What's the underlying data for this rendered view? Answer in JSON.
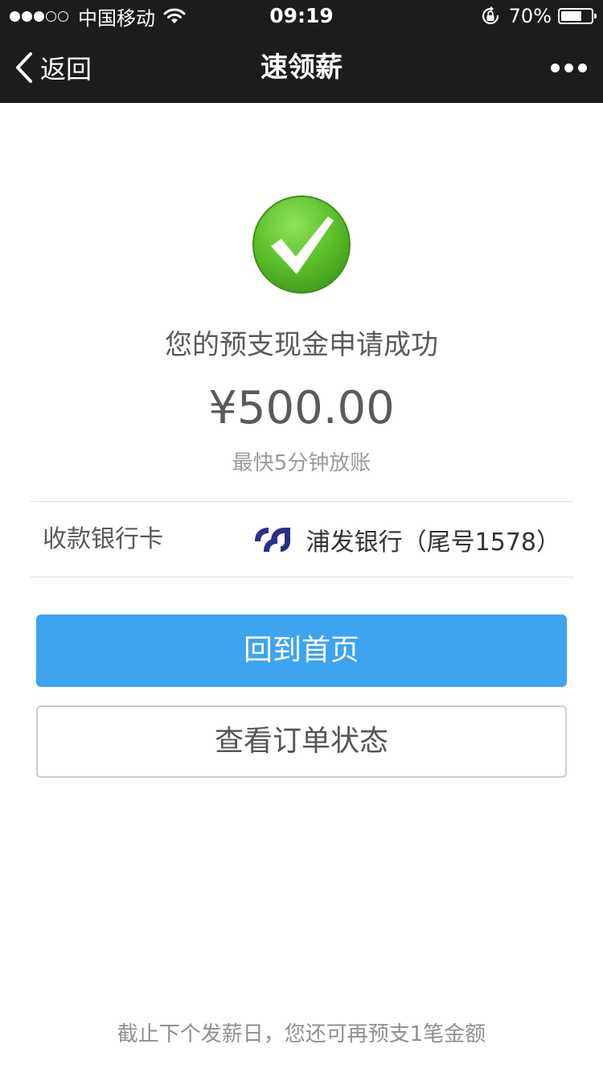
{
  "status_bar": {
    "carrier": "中国移动",
    "signal_bars_filled": 3,
    "signal_bars_total": 5,
    "time": "09:19",
    "battery_percent": "70%",
    "battery_level": 0.7
  },
  "nav": {
    "back_label": "返回",
    "title": "速领薪",
    "icons": {
      "back": "chevron-left-icon",
      "more": "more-dots-icon"
    }
  },
  "result": {
    "icon": "success-check-icon",
    "title": "您的预支现金申请成功",
    "amount": "¥500.00",
    "eta": "最快5分钟放账"
  },
  "bank": {
    "label": "收款银行卡",
    "name": "浦发银行（尾号1578）",
    "logo": "spdb-bank-logo"
  },
  "buttons": {
    "home": "回到首页",
    "order_status": "查看订单状态"
  },
  "footer": {
    "note": "截止下个发薪日，您还可再预支1笔金额"
  },
  "colors": {
    "bar_bg": "#1c1c1e",
    "primary": "#3da4f0",
    "success_green": "#5cc02a",
    "bank_logo": "#2b2f86",
    "text_dark": "#5a5a5a",
    "text_muted": "#9a9a9a"
  }
}
